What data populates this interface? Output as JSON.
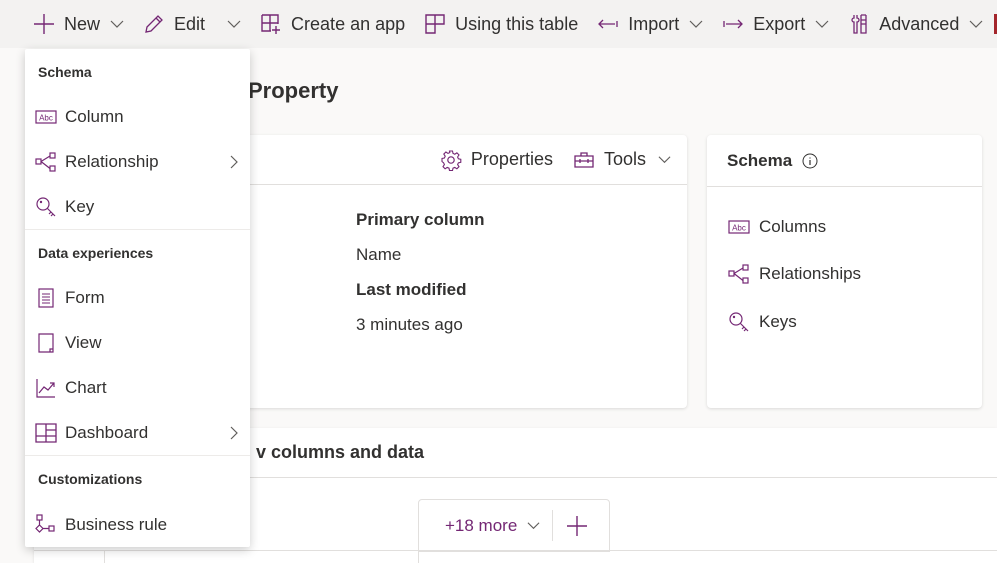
{
  "toolbar": {
    "new_label": "New",
    "edit_label": "Edit",
    "create_app_label": "Create an app",
    "using_table_label": "Using this table",
    "import_label": "Import",
    "export_label": "Export",
    "advanced_label": "Advanced"
  },
  "page": {
    "title": "Property"
  },
  "properties_card": {
    "properties_label": "Properties",
    "tools_label": "Tools",
    "primary_column_label": "Primary column",
    "primary_column_value": "Name",
    "last_modified_label": "Last modified",
    "last_modified_value": "3 minutes ago"
  },
  "schema_card": {
    "title": "Schema",
    "items": [
      {
        "label": "Columns",
        "icon": "abc-column-icon"
      },
      {
        "label": "Relationships",
        "icon": "relationship-icon"
      },
      {
        "label": "Keys",
        "icon": "key-icon"
      }
    ]
  },
  "data_section": {
    "title_partial": "v columns and data",
    "more_label": "+18 more"
  },
  "new_menu": {
    "groups": [
      {
        "label": "Schema",
        "items": [
          {
            "label": "Column",
            "icon": "abc-column-icon",
            "submenu": false
          },
          {
            "label": "Relationship",
            "icon": "relationship-icon",
            "submenu": true
          },
          {
            "label": "Key",
            "icon": "key-icon",
            "submenu": false
          }
        ]
      },
      {
        "label": "Data experiences",
        "items": [
          {
            "label": "Form",
            "icon": "form-icon",
            "submenu": false
          },
          {
            "label": "View",
            "icon": "view-icon",
            "submenu": false
          },
          {
            "label": "Chart",
            "icon": "chart-icon",
            "submenu": false
          },
          {
            "label": "Dashboard",
            "icon": "dashboard-icon",
            "submenu": true
          }
        ]
      },
      {
        "label": "Customizations",
        "items": [
          {
            "label": "Business rule",
            "icon": "business-rule-icon",
            "submenu": false
          }
        ]
      }
    ]
  },
  "colors": {
    "accent": "#742774",
    "text": "#323130",
    "toolbar_bg": "#f3f2f1",
    "page_bg": "#faf9f8"
  }
}
